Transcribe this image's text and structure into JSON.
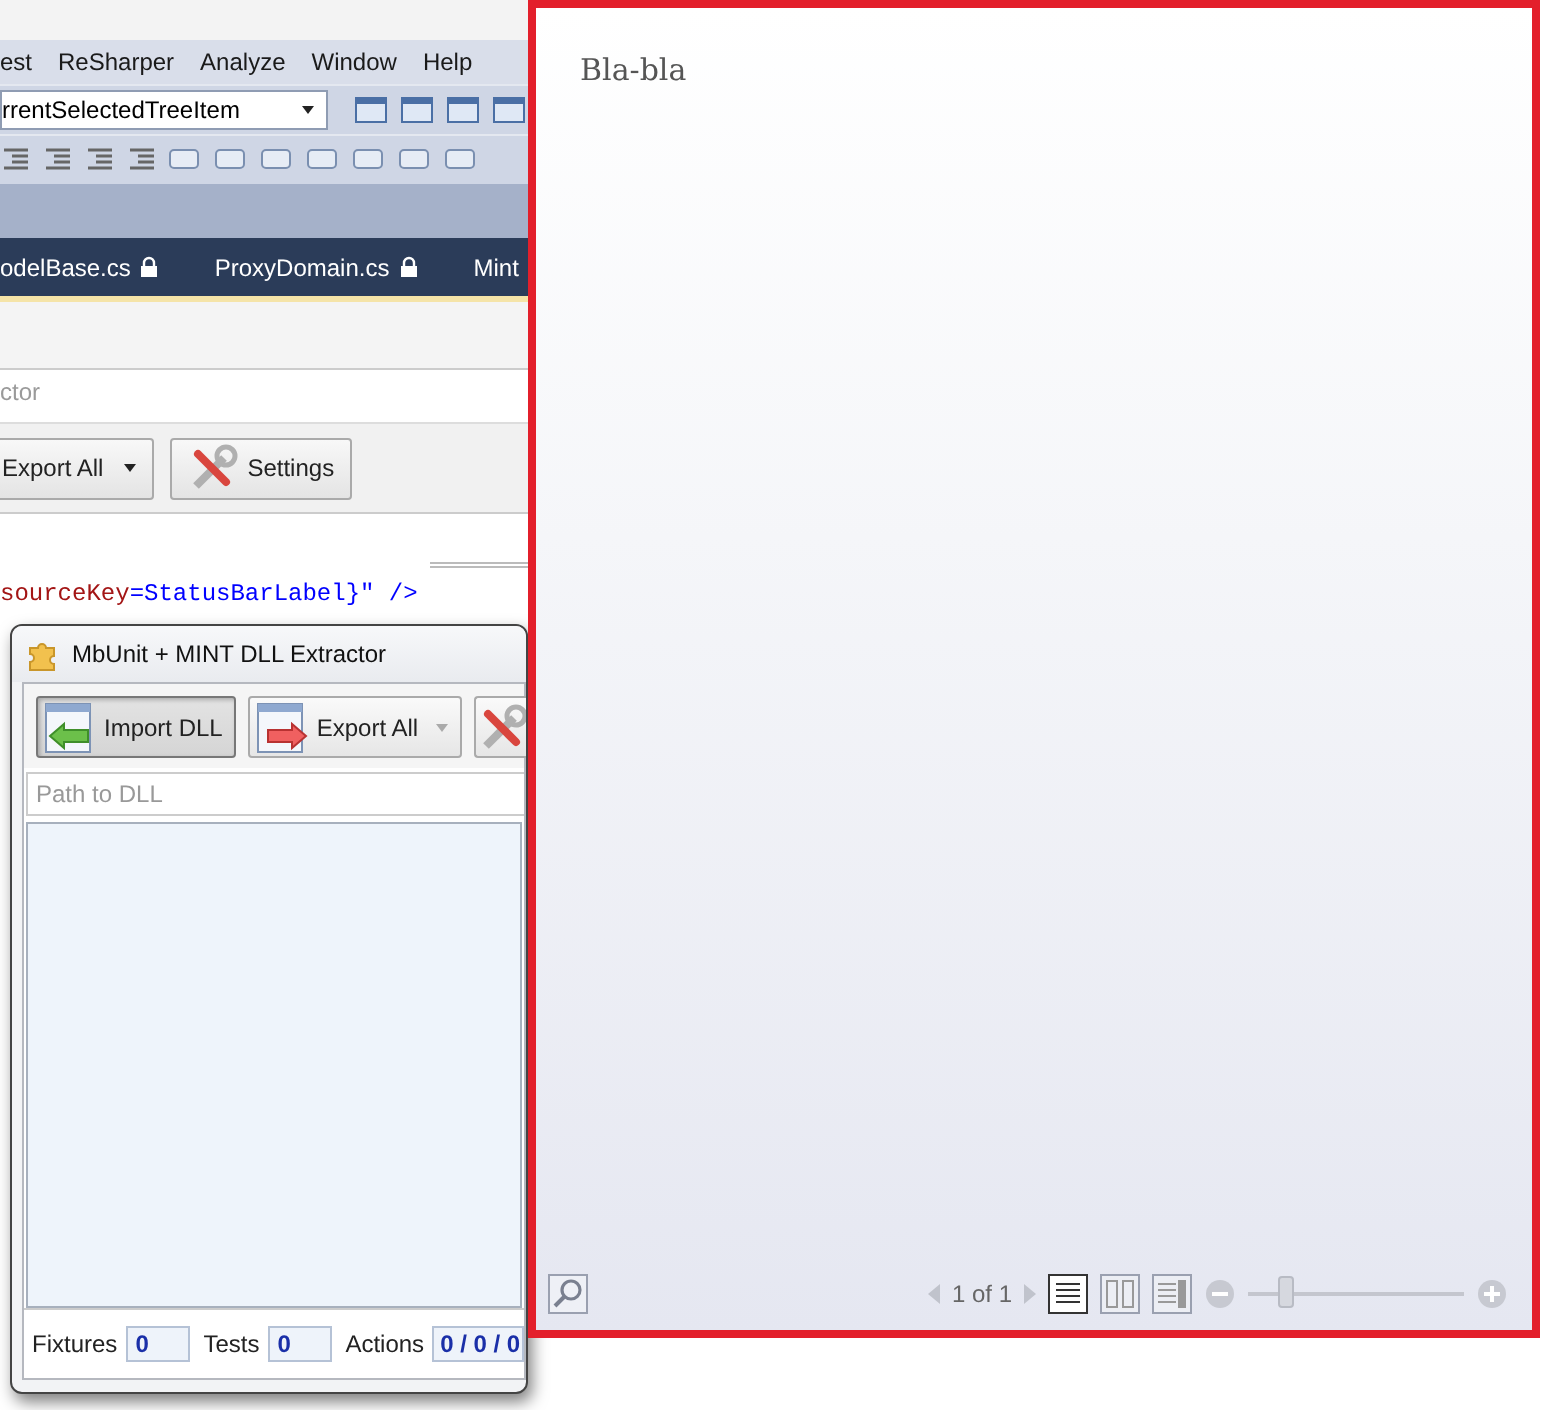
{
  "ide": {
    "menu": [
      "est",
      "ReSharper",
      "Analyze",
      "Window",
      "Help"
    ],
    "combo": {
      "value": "rrentSelectedTreeItem"
    },
    "tabs": [
      {
        "label": "odelBase.cs",
        "locked": true
      },
      {
        "label": "ProxyDomain.cs",
        "locked": true
      },
      {
        "label": "Mint",
        "locked": false
      }
    ]
  },
  "back_window": {
    "title": "ctor",
    "buttons": [
      {
        "label": "Export All",
        "kind": "split"
      },
      {
        "label": "Settings",
        "kind": "settings"
      }
    ]
  },
  "code_line": [
    {
      "text": "sourceKey",
      "color": "#a31515"
    },
    {
      "text": "=StatusBarLabel}\" />",
      "color": "#0000ff"
    }
  ],
  "extractor": {
    "title": "MbUnit + MINT DLL Extractor",
    "buttons": [
      {
        "label": "Import DLL",
        "kind": "import",
        "pressed": true
      },
      {
        "label": "Export All",
        "kind": "export",
        "pressed": false
      }
    ],
    "path": {
      "placeholder": "Path to DLL"
    },
    "status": [
      {
        "label": "Fixtures",
        "value": "0"
      },
      {
        "label": "Tests",
        "value": "0"
      },
      {
        "label": "Actions",
        "value": "0 / 0 / 0"
      }
    ]
  },
  "preview": {
    "text": "Bla-bla",
    "page_label": "1 of 1",
    "view_modes": [
      {
        "kind": "single",
        "selected": true
      },
      {
        "kind": "double",
        "selected": false
      },
      {
        "kind": "side",
        "selected": false
      }
    ],
    "zoom": {
      "level": 0.15
    }
  }
}
